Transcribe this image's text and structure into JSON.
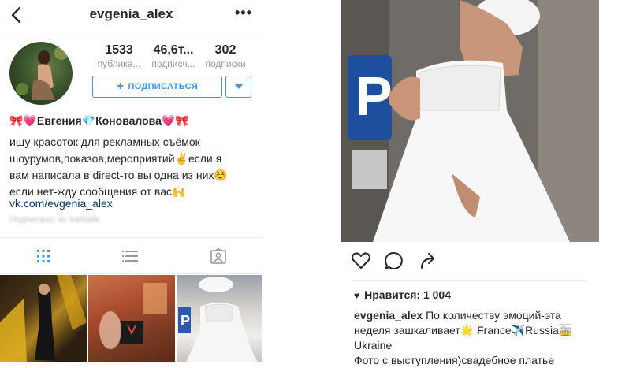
{
  "profile": {
    "username": "evgenia_alex",
    "more": "•••",
    "stats": [
      {
        "value": "1533",
        "label": "публика..."
      },
      {
        "value": "46,6т...",
        "label": "подписч..."
      },
      {
        "value": "302",
        "label": "подписки"
      }
    ],
    "follow_label": "ПОДПИСАТЬСЯ",
    "full_name": "🎀💗Евгения💎Коновалова💗🎀",
    "bio_lines": [
      "ищу красоток для рекламных съёмок",
      "шоурумов,показов,мероприятий✌️если я",
      "вам написала в direct-то вы одна из них☺️",
      "если нет-жду сообщения от вас🙌"
    ],
    "link": "vk.com/evgenia_alex",
    "followed_by": "Подписано: kc karbalik"
  },
  "tabs": [
    "grid",
    "list",
    "tagged"
  ],
  "post": {
    "likes": "Нравится: 1 004",
    "caption_user": "evgenia_alex",
    "caption_lines": [
      "По количеству эмоций-эта",
      "неделя зашкаливает🌟 France✈️Russia🚋",
      "Ukraine",
      "Фото с выступления)свадебное платье"
    ]
  },
  "colors": {
    "accent": "#3897f0",
    "link": "#003569",
    "text": "#262626",
    "muted": "#999999"
  }
}
